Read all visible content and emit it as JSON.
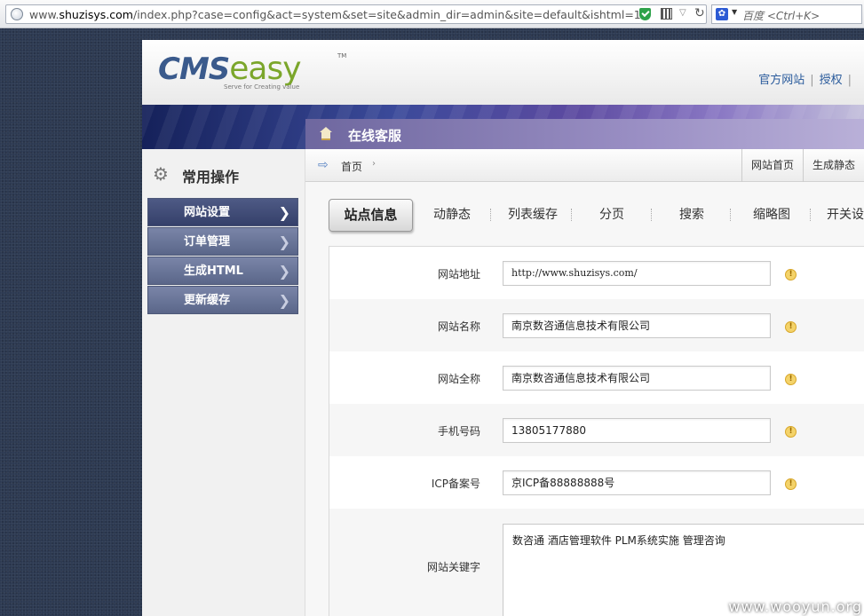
{
  "browser": {
    "url_prefix": "www.",
    "url_domain": "shuzisys.com",
    "url_path": "/index.php?case=config&act=system&set=site&admin_dir=admin&site=default&ishtml=1",
    "search_placeholder": "百度 <Ctrl+K>"
  },
  "header": {
    "logo_cms": "CMS",
    "logo_easy": "easy",
    "logo_tm": "TM",
    "logo_tagline": "Serve for Creating value",
    "links": [
      "官方网站",
      "授权",
      ""
    ]
  },
  "banner": {
    "tab_label": "在线客服"
  },
  "sidebar": {
    "title": "常用操作",
    "items": [
      {
        "label": "网站设置",
        "active": true
      },
      {
        "label": "订单管理",
        "active": false
      },
      {
        "label": "生成HTML",
        "active": false
      },
      {
        "label": "更新缓存",
        "active": false
      }
    ]
  },
  "breadcrumb": {
    "home": "首页",
    "right_links": [
      "网站首页",
      "生成静态"
    ]
  },
  "tabs": {
    "active": "站点信息",
    "others": [
      "动静态",
      "列表缓存",
      "分页",
      "搜索",
      "缩略图",
      "开关设"
    ]
  },
  "form": {
    "rows": [
      {
        "label": "网站地址",
        "value": "http://www.shuzisys.com/"
      },
      {
        "label": "网站名称",
        "value": "南京数咨通信息技术有限公司"
      },
      {
        "label": "网站全称",
        "value": "南京数咨通信息技术有限公司"
      },
      {
        "label": "手机号码",
        "value": "13805177880"
      },
      {
        "label": "ICP备案号",
        "value": "京ICP备88888888号"
      }
    ],
    "keywords": {
      "label": "网站关键字",
      "value": "数咨通 酒店管理软件 PLM系统实施 管理咨询"
    },
    "warn_glyph": "!"
  },
  "watermark": "www.wooyun.org"
}
